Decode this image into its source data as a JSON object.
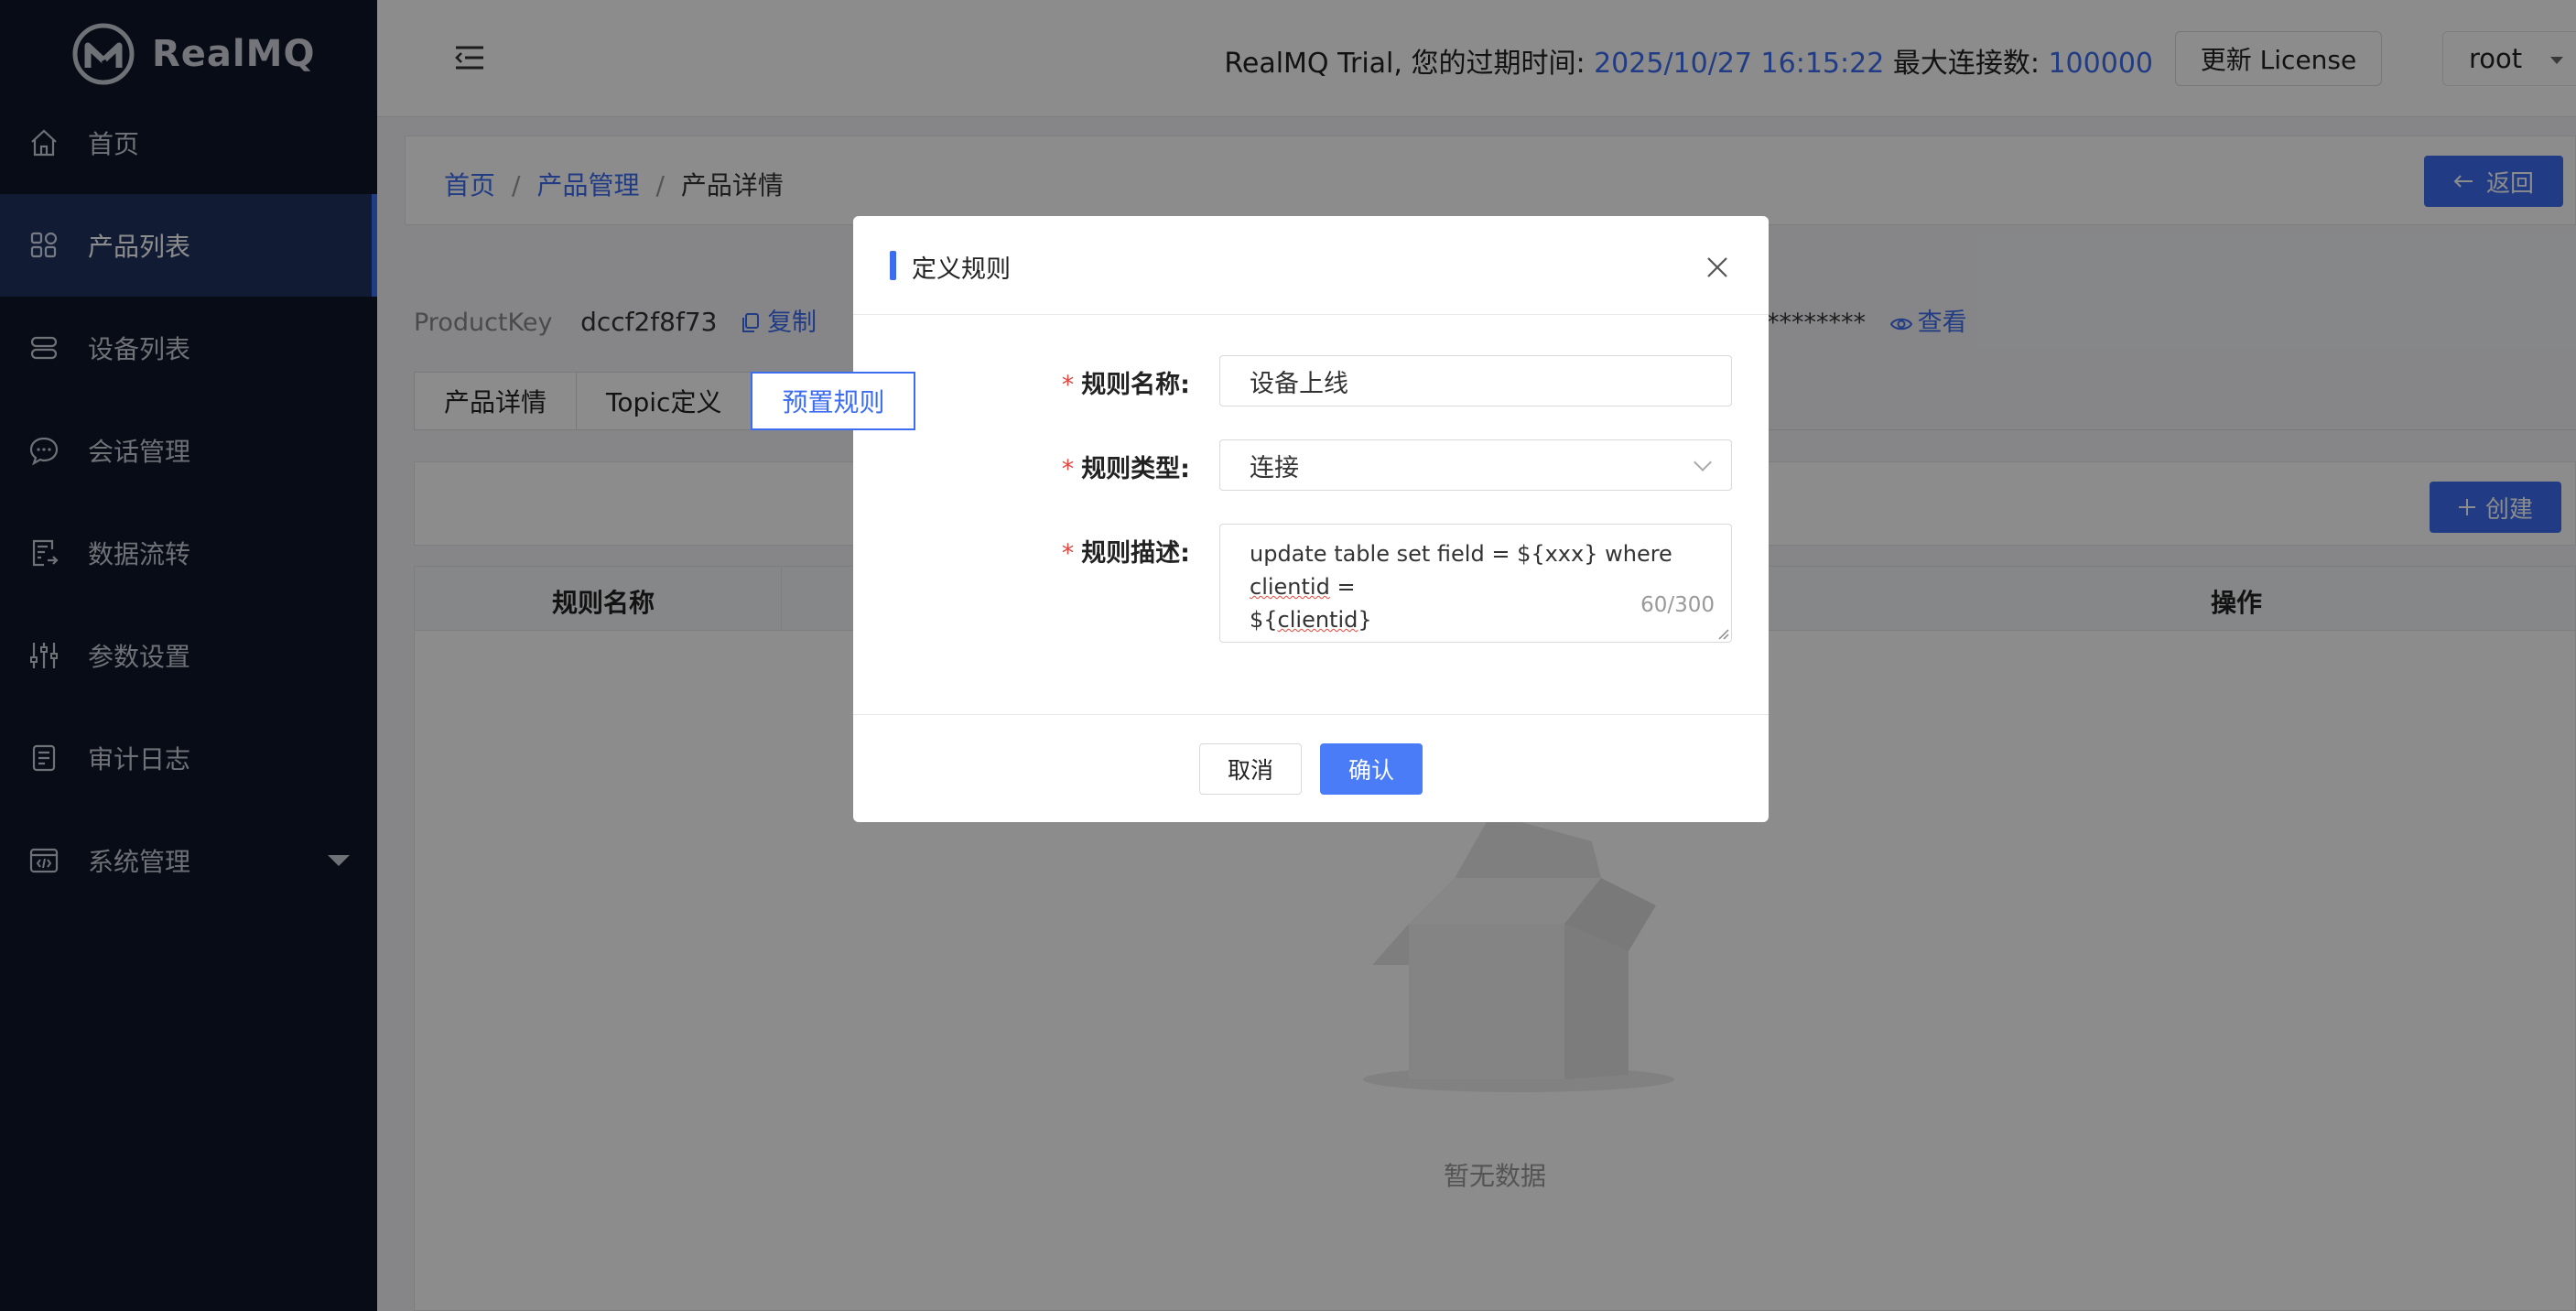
{
  "app": {
    "logo_text": "RealMQ"
  },
  "sidebar": {
    "items": [
      {
        "label": "首页",
        "icon": "home-icon"
      },
      {
        "label": "产品列表",
        "icon": "grid-icon",
        "active": true
      },
      {
        "label": "设备列表",
        "icon": "server-icon"
      },
      {
        "label": "会话管理",
        "icon": "chat-icon"
      },
      {
        "label": "数据流转",
        "icon": "document-flow-icon"
      },
      {
        "label": "参数设置",
        "icon": "sliders-icon"
      },
      {
        "label": "审计日志",
        "icon": "log-icon"
      },
      {
        "label": "系统管理",
        "icon": "code-window-icon",
        "expandable": true
      }
    ]
  },
  "header": {
    "trial_prefix": "RealMQ Trial, 您的过期时间: ",
    "expire_time": "2025/10/27 16:15:22",
    "max_conn_label": " 最大连接数: ",
    "max_conn": "100000",
    "license_button": "更新 License",
    "user": "root"
  },
  "breadcrumb": {
    "home": "首页",
    "product_mgmt": "产品管理",
    "current": "产品详情",
    "back_button": "返回"
  },
  "product": {
    "key_label": "ProductKey",
    "key_value": "dccf2f8f73",
    "copy_label": "复制",
    "secret_masked": "********",
    "view_label": "查看"
  },
  "tabs": [
    {
      "label": "产品详情"
    },
    {
      "label": "Topic定义"
    },
    {
      "label": "预置规则",
      "active": true
    }
  ],
  "toolbar": {
    "create_button": "创建"
  },
  "table": {
    "columns": [
      "规则名称",
      "操作"
    ],
    "empty_text": "暂无数据"
  },
  "modal": {
    "title": "定义规则",
    "fields": {
      "name_label": "规则名称:",
      "name_value": "设备上线",
      "type_label": "规则类型:",
      "type_value": "连接",
      "desc_label": "规则描述:",
      "desc_part1": "update table set field = ${xxx} where ",
      "desc_word1": "clientid",
      "desc_part2": " = ",
      "desc_part3": "${",
      "desc_word2": "clientid",
      "desc_part4": "}",
      "desc_counter": "60/300"
    },
    "cancel_button": "取消",
    "confirm_button": "确认"
  },
  "colors": {
    "accent": "#3c6df0",
    "sidebar_bg": "#0f1629",
    "sidebar_active": "#1f3360",
    "required": "#e8453c"
  }
}
